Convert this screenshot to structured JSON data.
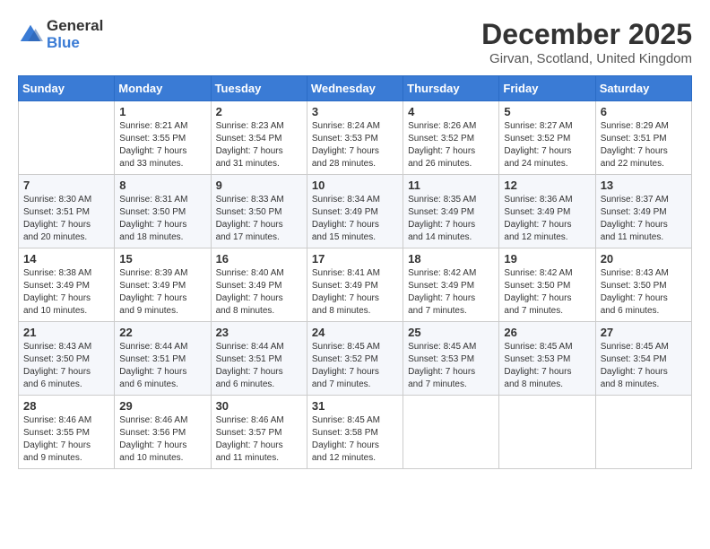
{
  "logo": {
    "general": "General",
    "blue": "Blue"
  },
  "header": {
    "title": "December 2025",
    "subtitle": "Girvan, Scotland, United Kingdom"
  },
  "calendar": {
    "days_of_week": [
      "Sunday",
      "Monday",
      "Tuesday",
      "Wednesday",
      "Thursday",
      "Friday",
      "Saturday"
    ],
    "weeks": [
      [
        {
          "day": "",
          "info": ""
        },
        {
          "day": "1",
          "info": "Sunrise: 8:21 AM\nSunset: 3:55 PM\nDaylight: 7 hours\nand 33 minutes."
        },
        {
          "day": "2",
          "info": "Sunrise: 8:23 AM\nSunset: 3:54 PM\nDaylight: 7 hours\nand 31 minutes."
        },
        {
          "day": "3",
          "info": "Sunrise: 8:24 AM\nSunset: 3:53 PM\nDaylight: 7 hours\nand 28 minutes."
        },
        {
          "day": "4",
          "info": "Sunrise: 8:26 AM\nSunset: 3:52 PM\nDaylight: 7 hours\nand 26 minutes."
        },
        {
          "day": "5",
          "info": "Sunrise: 8:27 AM\nSunset: 3:52 PM\nDaylight: 7 hours\nand 24 minutes."
        },
        {
          "day": "6",
          "info": "Sunrise: 8:29 AM\nSunset: 3:51 PM\nDaylight: 7 hours\nand 22 minutes."
        }
      ],
      [
        {
          "day": "7",
          "info": "Sunrise: 8:30 AM\nSunset: 3:51 PM\nDaylight: 7 hours\nand 20 minutes."
        },
        {
          "day": "8",
          "info": "Sunrise: 8:31 AM\nSunset: 3:50 PM\nDaylight: 7 hours\nand 18 minutes."
        },
        {
          "day": "9",
          "info": "Sunrise: 8:33 AM\nSunset: 3:50 PM\nDaylight: 7 hours\nand 17 minutes."
        },
        {
          "day": "10",
          "info": "Sunrise: 8:34 AM\nSunset: 3:49 PM\nDaylight: 7 hours\nand 15 minutes."
        },
        {
          "day": "11",
          "info": "Sunrise: 8:35 AM\nSunset: 3:49 PM\nDaylight: 7 hours\nand 14 minutes."
        },
        {
          "day": "12",
          "info": "Sunrise: 8:36 AM\nSunset: 3:49 PM\nDaylight: 7 hours\nand 12 minutes."
        },
        {
          "day": "13",
          "info": "Sunrise: 8:37 AM\nSunset: 3:49 PM\nDaylight: 7 hours\nand 11 minutes."
        }
      ],
      [
        {
          "day": "14",
          "info": "Sunrise: 8:38 AM\nSunset: 3:49 PM\nDaylight: 7 hours\nand 10 minutes."
        },
        {
          "day": "15",
          "info": "Sunrise: 8:39 AM\nSunset: 3:49 PM\nDaylight: 7 hours\nand 9 minutes."
        },
        {
          "day": "16",
          "info": "Sunrise: 8:40 AM\nSunset: 3:49 PM\nDaylight: 7 hours\nand 8 minutes."
        },
        {
          "day": "17",
          "info": "Sunrise: 8:41 AM\nSunset: 3:49 PM\nDaylight: 7 hours\nand 8 minutes."
        },
        {
          "day": "18",
          "info": "Sunrise: 8:42 AM\nSunset: 3:49 PM\nDaylight: 7 hours\nand 7 minutes."
        },
        {
          "day": "19",
          "info": "Sunrise: 8:42 AM\nSunset: 3:50 PM\nDaylight: 7 hours\nand 7 minutes."
        },
        {
          "day": "20",
          "info": "Sunrise: 8:43 AM\nSunset: 3:50 PM\nDaylight: 7 hours\nand 6 minutes."
        }
      ],
      [
        {
          "day": "21",
          "info": "Sunrise: 8:43 AM\nSunset: 3:50 PM\nDaylight: 7 hours\nand 6 minutes."
        },
        {
          "day": "22",
          "info": "Sunrise: 8:44 AM\nSunset: 3:51 PM\nDaylight: 7 hours\nand 6 minutes."
        },
        {
          "day": "23",
          "info": "Sunrise: 8:44 AM\nSunset: 3:51 PM\nDaylight: 7 hours\nand 6 minutes."
        },
        {
          "day": "24",
          "info": "Sunrise: 8:45 AM\nSunset: 3:52 PM\nDaylight: 7 hours\nand 7 minutes."
        },
        {
          "day": "25",
          "info": "Sunrise: 8:45 AM\nSunset: 3:53 PM\nDaylight: 7 hours\nand 7 minutes."
        },
        {
          "day": "26",
          "info": "Sunrise: 8:45 AM\nSunset: 3:53 PM\nDaylight: 7 hours\nand 8 minutes."
        },
        {
          "day": "27",
          "info": "Sunrise: 8:45 AM\nSunset: 3:54 PM\nDaylight: 7 hours\nand 8 minutes."
        }
      ],
      [
        {
          "day": "28",
          "info": "Sunrise: 8:46 AM\nSunset: 3:55 PM\nDaylight: 7 hours\nand 9 minutes."
        },
        {
          "day": "29",
          "info": "Sunrise: 8:46 AM\nSunset: 3:56 PM\nDaylight: 7 hours\nand 10 minutes."
        },
        {
          "day": "30",
          "info": "Sunrise: 8:46 AM\nSunset: 3:57 PM\nDaylight: 7 hours\nand 11 minutes."
        },
        {
          "day": "31",
          "info": "Sunrise: 8:45 AM\nSunset: 3:58 PM\nDaylight: 7 hours\nand 12 minutes."
        },
        {
          "day": "",
          "info": ""
        },
        {
          "day": "",
          "info": ""
        },
        {
          "day": "",
          "info": ""
        }
      ]
    ]
  }
}
